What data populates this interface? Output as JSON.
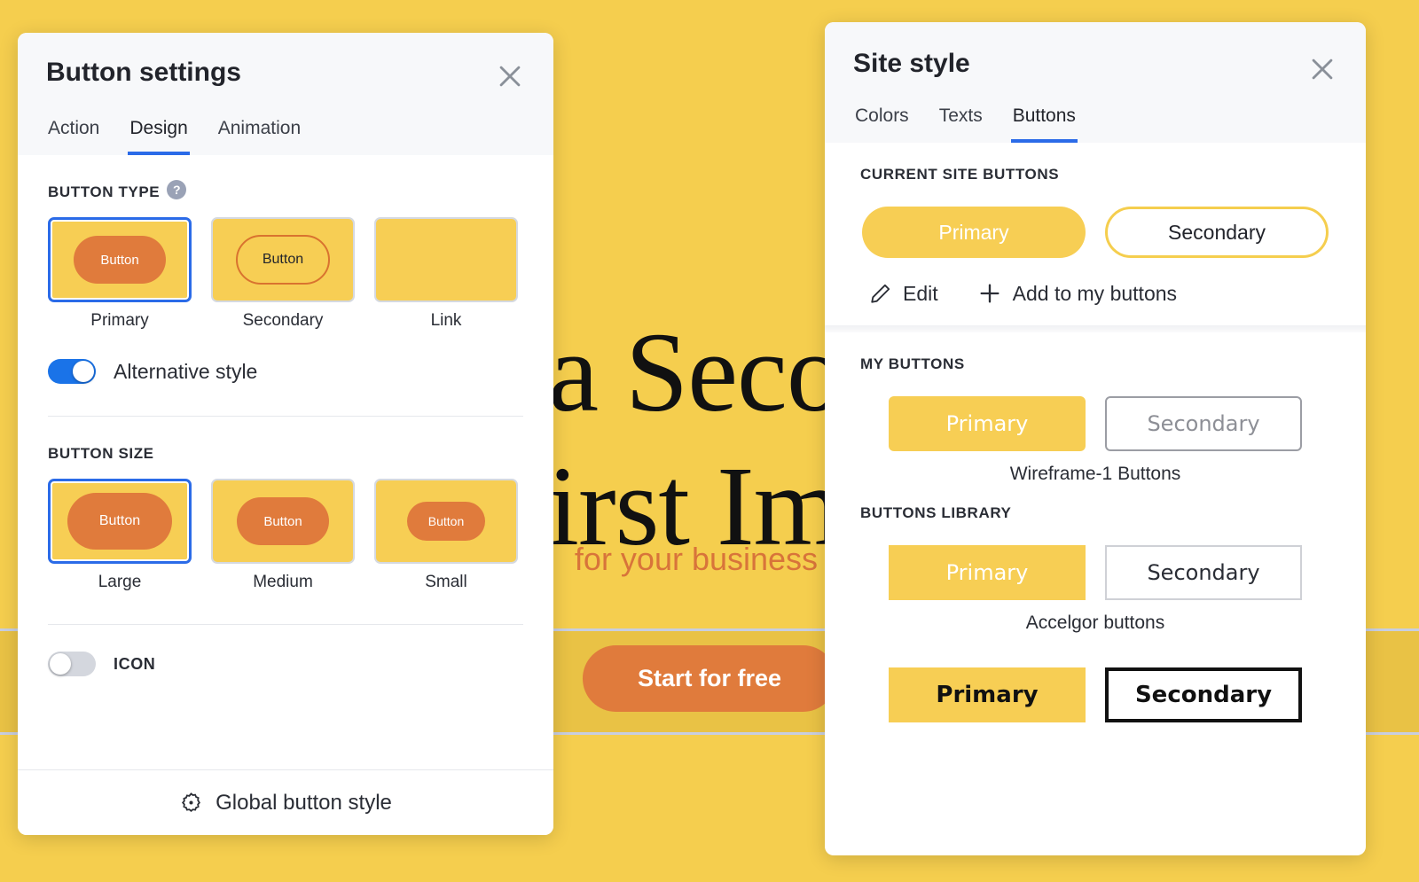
{
  "background_site": {
    "headline_line1": "o a Second",
    "headline_line2": "First Impr",
    "subtitle": "for your business a",
    "cta_label": "Start for free"
  },
  "button_settings_panel": {
    "title": "Button settings",
    "close_icon": "close-icon",
    "tabs": [
      {
        "label": "Action",
        "active": false
      },
      {
        "label": "Design",
        "active": true
      },
      {
        "label": "Animation",
        "active": false
      }
    ],
    "button_type": {
      "section_label": "BUTTON TYPE",
      "help_icon": "help-icon",
      "help_glyph": "?",
      "options": [
        {
          "label": "Primary",
          "selected": true,
          "preview": "filled",
          "preview_text": "Button"
        },
        {
          "label": "Secondary",
          "selected": false,
          "preview": "outline",
          "preview_text": "Button"
        },
        {
          "label": "Link",
          "selected": false,
          "preview": "none",
          "preview_text": ""
        }
      ]
    },
    "alternative_style": {
      "label": "Alternative style",
      "enabled": true
    },
    "button_size": {
      "section_label": "BUTTON SIZE",
      "options": [
        {
          "label": "Large",
          "selected": true,
          "preview_text": "Button"
        },
        {
          "label": "Medium",
          "selected": false,
          "preview_text": "Button"
        },
        {
          "label": "Small",
          "selected": false,
          "preview_text": "Button"
        }
      ]
    },
    "icon_toggle": {
      "label": "ICON",
      "enabled": false
    },
    "footer": {
      "label": "Global button style",
      "icon": "gear-icon"
    }
  },
  "site_style_panel": {
    "title": "Site style",
    "close_icon": "close-icon",
    "tabs": [
      {
        "label": "Colors",
        "active": false
      },
      {
        "label": "Texts",
        "active": false
      },
      {
        "label": "Buttons",
        "active": true
      }
    ],
    "current_site_buttons": {
      "section_label": "CURRENT SITE BUTTONS",
      "primary_label": "Primary",
      "secondary_label": "Secondary",
      "actions": [
        {
          "label": "Edit",
          "icon": "pencil-icon"
        },
        {
          "label": "Add to my buttons",
          "icon": "plus-icon"
        }
      ]
    },
    "my_buttons": {
      "section_label": "MY BUTTONS",
      "sets": [
        {
          "primary_label": "Primary",
          "secondary_label": "Secondary",
          "caption": "Wireframe-1 Buttons"
        }
      ]
    },
    "buttons_library": {
      "section_label": "BUTTONS LIBRARY",
      "sets": [
        {
          "primary_label": "Primary",
          "secondary_label": "Secondary",
          "caption": "Accelgor buttons"
        },
        {
          "primary_label": "Primary",
          "secondary_label": "Secondary",
          "caption": ""
        }
      ]
    }
  },
  "colors": {
    "brand_yellow": "#F5CE4E",
    "tile_yellow": "#F7CE54",
    "accent_orange": "#E07B3C",
    "selection_blue": "#2B6BE8",
    "toggle_on_blue": "#1A73E8",
    "toggle_off_gray": "#D4D7DE",
    "panel_head_gray": "#F7F8FA",
    "text_dark": "#22242B"
  }
}
